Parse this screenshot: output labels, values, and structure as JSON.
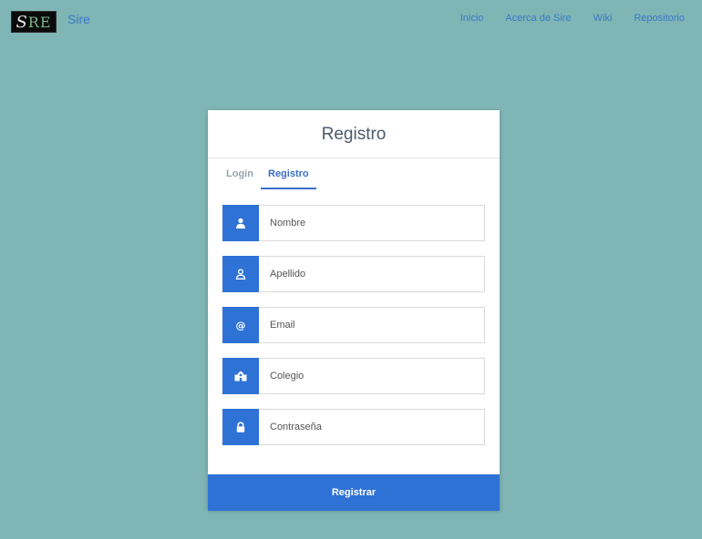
{
  "navbar": {
    "logo_text_s": "S",
    "logo_text_re": "RE",
    "brand": "Sire",
    "links": [
      "Inicio",
      "Acerca de Sire",
      "Wiki",
      "Repositorio"
    ]
  },
  "card": {
    "title": "Registro",
    "tabs": [
      {
        "label": "Login",
        "active": false
      },
      {
        "label": "Registro",
        "active": true
      }
    ],
    "fields": [
      {
        "placeholder": "Nombre",
        "icon": "user-icon"
      },
      {
        "placeholder": "Apellido",
        "icon": "user-outline-icon"
      },
      {
        "placeholder": "Email",
        "icon": "at-icon"
      },
      {
        "placeholder": "Colegio",
        "icon": "school-icon"
      },
      {
        "placeholder": "Contraseña",
        "icon": "lock-icon"
      }
    ],
    "submit_label": "Registrar"
  },
  "colors": {
    "background": "#7fb5b5",
    "accent": "#2f72d6",
    "link": "#3a7bc8"
  }
}
